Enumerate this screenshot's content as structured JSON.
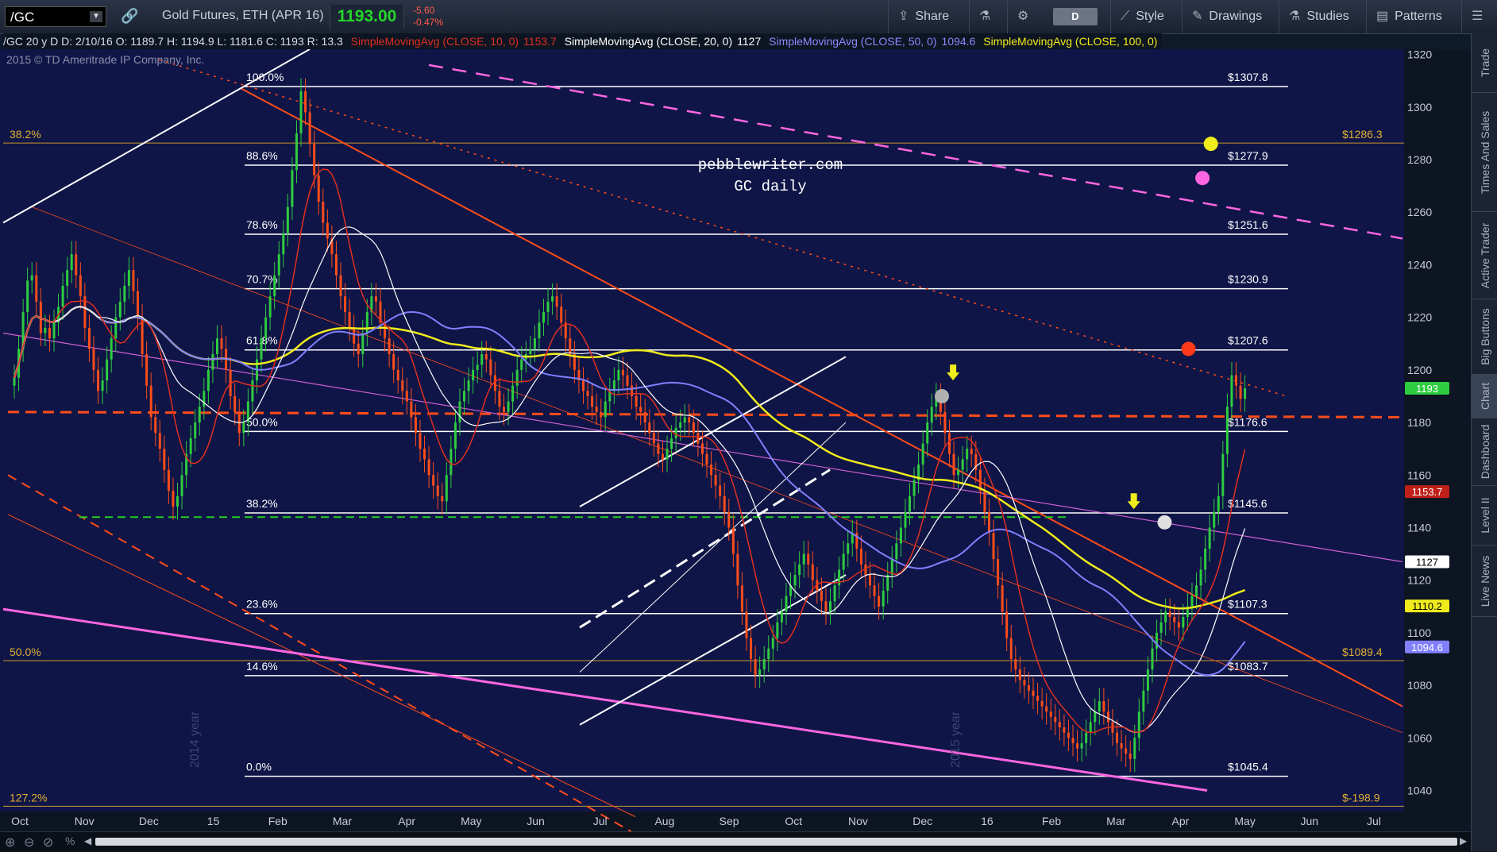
{
  "toolbar": {
    "symbol": "/GC",
    "description": "Gold Futures, ETH (APR 16)",
    "last_price": "1193.00",
    "change": "-5.60",
    "change_pct": "-0.47%",
    "share_label": "Share",
    "period_label": "D",
    "style_label": "Style",
    "drawings_label": "Drawings",
    "studies_label": "Studies",
    "patterns_label": "Patterns"
  },
  "legend": {
    "ohlc": "/GC 20 y D  D: 2/10/16  O: 1189.7  H: 1194.9  L: 1181.6  C: 1193  R: 13.3",
    "sma10_label": "SimpleMovingAvg (CLOSE, 10, 0)",
    "sma10_value": "1153.7",
    "sma20_label": "SimpleMovingAvg (CLOSE, 20, 0)",
    "sma20_value": "1127",
    "sma50_label": "SimpleMovingAvg (CLOSE, 50, 0)",
    "sma50_value": "1094.6",
    "sma100_label": "SimpleMovingAvg (CLOSE, 100, 0)"
  },
  "colors": {
    "background": "#0f1547",
    "candle_up": "#2ecc40",
    "candle_down": "#ff4d1a",
    "sma10": "#e03020",
    "sma20": "#ffffff",
    "sma50": "#8080ff",
    "sma100": "#f0ec1c",
    "channel": "#ff4d1a",
    "fib": "#ffffff",
    "magenta": "#ff66e0",
    "green_dash": "#22cc22",
    "axis_text": "#c8ccd6"
  },
  "right_tabs": [
    "Trade",
    "Times And Sales",
    "Active Trader",
    "Big Buttons",
    "Chart",
    "Dashboard",
    "Level II",
    "Live News"
  ],
  "chart_data": {
    "type": "candlestick",
    "title": "pebblewriter.com",
    "subtitle": "GC daily",
    "copyright": "2015 © TD Ameritrade IP Company, Inc.",
    "x_tick_labels": [
      "Oct",
      "Nov",
      "Dec",
      "15",
      "Feb",
      "Mar",
      "Apr",
      "May",
      "Jun",
      "Jul",
      "Aug",
      "Sep",
      "Oct",
      "Nov",
      "Dec",
      "16",
      "Feb",
      "Mar",
      "Apr",
      "May",
      "Jun",
      "Jul"
    ],
    "year_labels": [
      "2014 year",
      "2015 year"
    ],
    "ylim": [
      1032,
      1322
    ],
    "y_ticks": [
      1040,
      1060,
      1080,
      1100,
      1120,
      1140,
      1160,
      1180,
      1200,
      1220,
      1240,
      1260,
      1280,
      1300,
      1320
    ],
    "price_badges": [
      {
        "value": 1193,
        "label": "1193",
        "color": "#2ecc40"
      },
      {
        "value": 1153.7,
        "label": "1153.7",
        "color": "#c0201a"
      },
      {
        "value": 1127,
        "label": "1127",
        "color": "#ffffff"
      },
      {
        "value": 1110.2,
        "label": "1110.2",
        "color": "#f0ec1c"
      },
      {
        "value": 1094.6,
        "label": "1094.6",
        "color": "#8080ff"
      }
    ],
    "fib_levels": [
      {
        "pct": "100.0%",
        "value": 1307.8,
        "label": "$1307.8"
      },
      {
        "pct": "88.6%",
        "value": 1277.9,
        "label": "$1277.9"
      },
      {
        "pct": "78.6%",
        "value": 1251.6,
        "label": "$1251.6"
      },
      {
        "pct": "70.7%",
        "value": 1230.9,
        "label": "$1230.9"
      },
      {
        "pct": "61.8%",
        "value": 1207.6,
        "label": "$1207.6"
      },
      {
        "pct": "50.0%",
        "value": 1176.6,
        "label": "$1176.6"
      },
      {
        "pct": "38.2%",
        "value": 1145.6,
        "label": "$1145.6"
      },
      {
        "pct": "23.6%",
        "value": 1107.3,
        "label": "$1107.3"
      },
      {
        "pct": "14.6%",
        "value": 1083.7,
        "label": "$1083.7"
      },
      {
        "pct": "0.0%",
        "value": 1045.4,
        "label": "$1045.4"
      }
    ],
    "long_fib": [
      {
        "pct": "38.2%",
        "value": 1286.3,
        "label": "$1286.3"
      },
      {
        "pct": "50.0%",
        "value": 1089.4,
        "label": "$1089.4"
      },
      {
        "pct": "127.2%",
        "value": 1034,
        "label": "$-198.9"
      }
    ],
    "markers": [
      {
        "type": "circle",
        "color": "#f0ec1c",
        "x": 69.2,
        "y": 1286
      },
      {
        "type": "circle",
        "color": "#ff66e0",
        "x": 68.6,
        "y": 1273
      },
      {
        "type": "circle",
        "color": "#ff3a1a",
        "x": 67.6,
        "y": 1208
      },
      {
        "type": "circle",
        "color": "#b0b0b0",
        "x": 50.0,
        "y": 1190
      },
      {
        "type": "circle",
        "color": "#e0e0e0",
        "x": 65.9,
        "y": 1142
      },
      {
        "type": "arrow",
        "color": "#f0ec1c",
        "x": 50.8,
        "y": 1196
      },
      {
        "type": "arrow",
        "color": "#f0ec1c",
        "x": 63.7,
        "y": 1147
      }
    ],
    "close": [
      1197,
      1208,
      1222,
      1234,
      1236,
      1226,
      1214,
      1216,
      1212,
      1218,
      1224,
      1232,
      1238,
      1244,
      1236,
      1228,
      1216,
      1208,
      1200,
      1192,
      1196,
      1204,
      1212,
      1220,
      1226,
      1232,
      1238,
      1230,
      1220,
      1206,
      1194,
      1182,
      1176,
      1170,
      1162,
      1154,
      1148,
      1152,
      1160,
      1168,
      1174,
      1180,
      1186,
      1192,
      1200,
      1206,
      1212,
      1208,
      1200,
      1190,
      1184,
      1176,
      1180,
      1188,
      1196,
      1204,
      1212,
      1220,
      1228,
      1236,
      1244,
      1252,
      1262,
      1276,
      1290,
      1306,
      1298,
      1286,
      1274,
      1264,
      1256,
      1250,
      1244,
      1236,
      1228,
      1222,
      1216,
      1210,
      1206,
      1214,
      1222,
      1228,
      1226,
      1218,
      1212,
      1206,
      1200,
      1196,
      1192,
      1188,
      1182,
      1176,
      1170,
      1166,
      1160,
      1156,
      1152,
      1150,
      1160,
      1170,
      1180,
      1188,
      1192,
      1196,
      1200,
      1202,
      1206,
      1204,
      1198,
      1192,
      1186,
      1184,
      1188,
      1194,
      1200,
      1204,
      1206,
      1208,
      1212,
      1218,
      1222,
      1226,
      1228,
      1224,
      1218,
      1212,
      1206,
      1200,
      1196,
      1192,
      1190,
      1186,
      1184,
      1182,
      1188,
      1192,
      1196,
      1200,
      1198,
      1194,
      1190,
      1186,
      1184,
      1180,
      1176,
      1172,
      1168,
      1166,
      1170,
      1174,
      1178,
      1180,
      1182,
      1180,
      1176,
      1172,
      1168,
      1164,
      1160,
      1156,
      1152,
      1146,
      1140,
      1130,
      1118,
      1108,
      1098,
      1090,
      1084,
      1086,
      1090,
      1094,
      1098,
      1104,
      1108,
      1114,
      1118,
      1122,
      1126,
      1130,
      1126,
      1120,
      1116,
      1112,
      1108,
      1112,
      1118,
      1124,
      1130,
      1134,
      1138,
      1132,
      1126,
      1122,
      1118,
      1114,
      1110,
      1116,
      1122,
      1128,
      1134,
      1140,
      1146,
      1152,
      1158,
      1164,
      1172,
      1180,
      1186,
      1190,
      1184,
      1176,
      1168,
      1160,
      1162,
      1166,
      1170,
      1168,
      1162,
      1154,
      1146,
      1138,
      1128,
      1118,
      1108,
      1098,
      1090,
      1086,
      1082,
      1080,
      1078,
      1076,
      1074,
      1072,
      1070,
      1068,
      1066,
      1064,
      1062,
      1060,
      1058,
      1056,
      1058,
      1062,
      1066,
      1070,
      1074,
      1070,
      1066,
      1062,
      1058,
      1056,
      1054,
      1052,
      1060,
      1070,
      1078,
      1086,
      1094,
      1100,
      1104,
      1108,
      1106,
      1104,
      1102,
      1106,
      1110,
      1114,
      1118,
      1124,
      1132,
      1140,
      1146,
      1152,
      1168,
      1186,
      1198,
      1194,
      1189,
      1193
    ]
  }
}
